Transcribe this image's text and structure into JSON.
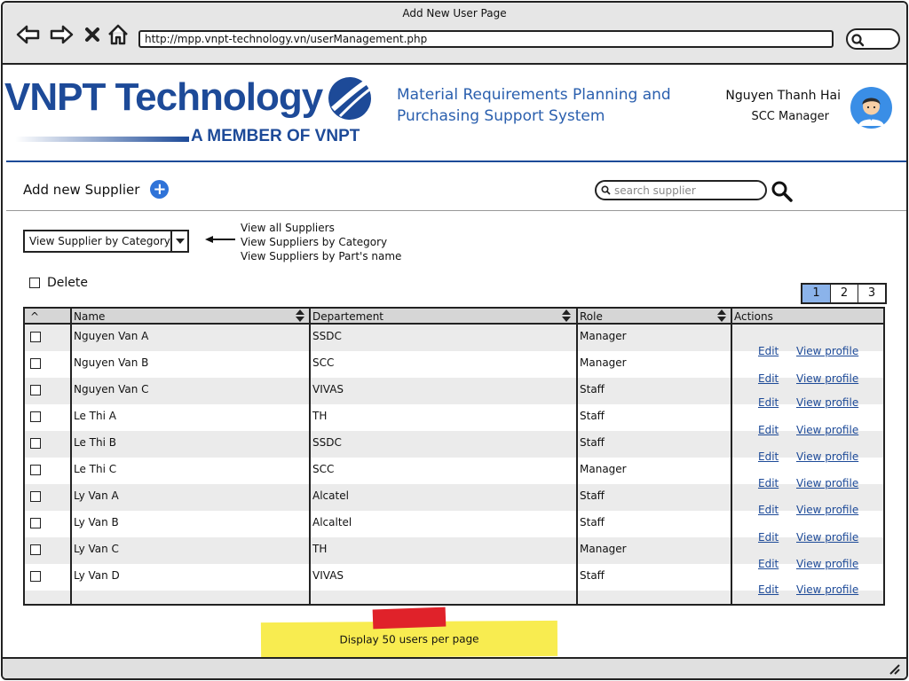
{
  "window": {
    "title": "Add New User Page"
  },
  "browser": {
    "url": "http://mpp.vnpt-technology.vn/userManagement.php",
    "icons": [
      "back-arrow-icon",
      "forward-arrow-icon",
      "close-x-icon",
      "home-icon",
      "search-icon"
    ]
  },
  "header": {
    "logo_text": "VNPT Technology",
    "logo_subtext": "A MEMBER OF VNPT",
    "app_title_line1": "Material Requirements Planning and",
    "app_title_line2": "Purchasing Support System",
    "user_name": "Nguyen Thanh Hai",
    "user_role": "SCC Manager",
    "brand_color": "#1d4a98",
    "title_color": "#2a5fae"
  },
  "toolbar": {
    "add_label": "Add new Supplier",
    "search_placeholder": "search supplier"
  },
  "view_filter": {
    "selected": "View Supplier by Category",
    "options": [
      "View all Suppliers",
      "View Suppliers by Category",
      "View Suppliers by Part's name"
    ]
  },
  "delete_label": "Delete",
  "pagination": {
    "pages": [
      "1",
      "2",
      "3"
    ],
    "current": "1",
    "current_color": "#8bb3ea"
  },
  "table": {
    "headers": {
      "select": "^",
      "name": "Name",
      "department": "Departement",
      "role": "Role",
      "actions": "Actions"
    },
    "rows": [
      {
        "name": "Nguyen Van A",
        "department": "SSDC",
        "role": "Manager"
      },
      {
        "name": "Nguyen Van B",
        "department": "SCC",
        "role": "Manager"
      },
      {
        "name": "Nguyen Van C",
        "department": "VIVAS",
        "role": "Staff"
      },
      {
        "name": "Le Thi A",
        "department": "TH",
        "role": "Staff"
      },
      {
        "name": "Le Thi B",
        "department": "SSDC",
        "role": "Staff"
      },
      {
        "name": "Le Thi C",
        "department": "SCC",
        "role": "Manager"
      },
      {
        "name": "Ly Van A",
        "department": "Alcatel",
        "role": "Staff"
      },
      {
        "name": "Ly Van B",
        "department": "Alcaltel",
        "role": "Staff"
      },
      {
        "name": "Ly Van C",
        "department": "TH",
        "role": "Manager"
      },
      {
        "name": "Ly Van D",
        "department": "VIVAS",
        "role": "Staff"
      }
    ],
    "action_edit": "Edit",
    "action_view": "View profile"
  },
  "note": {
    "text": "Display 50 users per page",
    "color": "#f8ec50"
  }
}
